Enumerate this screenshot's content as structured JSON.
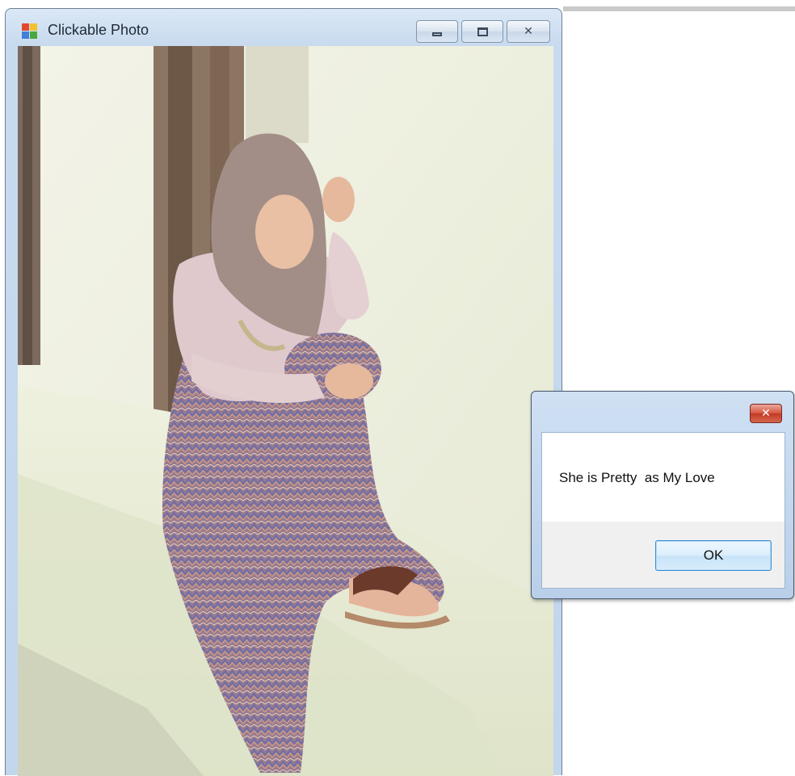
{
  "window": {
    "title": "Clickable Photo",
    "icon": "app-window-icon",
    "buttons": {
      "minimize_icon": "minimize-icon",
      "maximize_icon": "maximize-icon",
      "close_icon": "close-icon"
    }
  },
  "photo": {
    "description_icon": "photo-woman-sitting"
  },
  "dialog": {
    "message": "She is Pretty  as My Love",
    "ok_label": "OK",
    "close_icon": "close-icon"
  },
  "colors": {
    "window_frame": "#c2d6ec",
    "dialog_close": "#c23a25",
    "ok_border": "#3b8cd1"
  }
}
